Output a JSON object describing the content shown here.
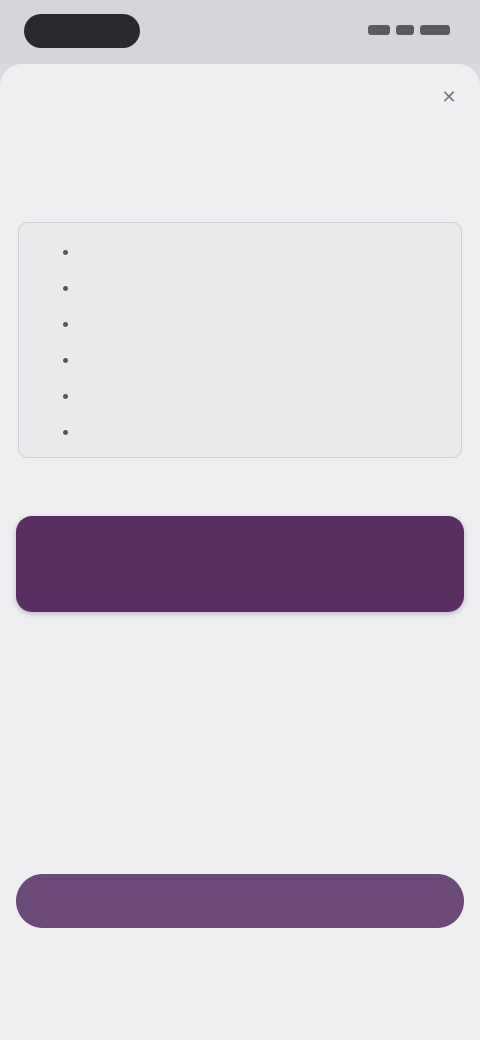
{
  "status_bar": {},
  "sheet": {
    "close_label": "✕",
    "title": "",
    "subtitle": "",
    "features": [
      "",
      "",
      "",
      "",
      "",
      ""
    ],
    "section_label": "",
    "plan": {
      "name": "",
      "price": ""
    },
    "cta_label": "",
    "footer_links": [
      "",
      "",
      ""
    ]
  },
  "colors": {
    "accent": "#5a2e62",
    "cta": "#6b4a7a",
    "background": "#efeff1"
  }
}
